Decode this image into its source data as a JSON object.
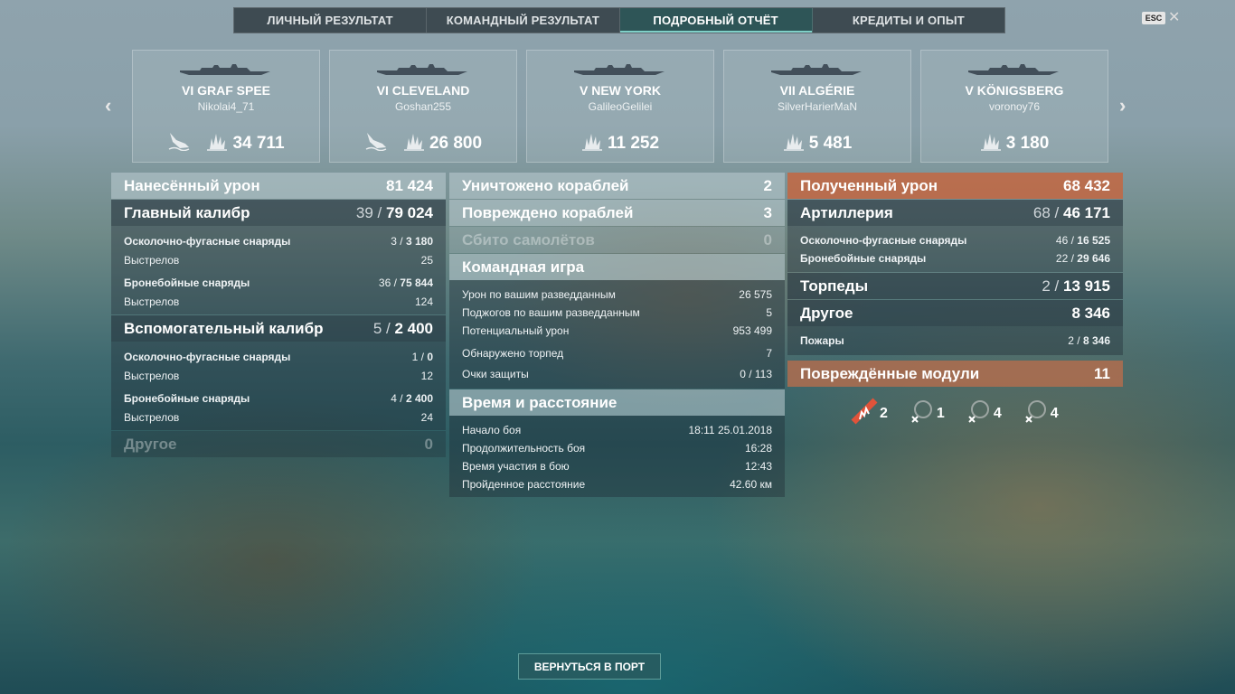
{
  "tabs": [
    "ЛИЧНЫЙ РЕЗУЛЬТАТ",
    "КОМАНДНЫЙ РЕЗУЛЬТАТ",
    "ПОДРОБНЫЙ ОТЧЁТ",
    "КРЕДИТЫ И ОПЫТ"
  ],
  "active_tab": 2,
  "esc_label": "ESC",
  "ships": [
    {
      "tier_name": "VI GRAF SPEE",
      "player": "Nikolai4_71",
      "damage": "34 711",
      "sunk": true
    },
    {
      "tier_name": "VI CLEVELAND",
      "player": "Goshan255",
      "damage": "26 800",
      "sunk": true
    },
    {
      "tier_name": "V NEW YORK",
      "player": "GalileoGelilei",
      "damage": "11 252",
      "sunk": false
    },
    {
      "tier_name": "VII ALGÉRIE",
      "player": "SilverHarierMaN",
      "damage": "5 481",
      "sunk": false
    },
    {
      "tier_name": "V KÖNIGSBERG",
      "player": "voronoy76",
      "damage": "3 180",
      "sunk": false
    }
  ],
  "dealt": {
    "title": "Нанесённый урон",
    "total": "81 424",
    "main": {
      "label": "Главный калибр",
      "hits": "39",
      "dmg": "79 024",
      "he": {
        "label": "Осколочно-фугасные снаряды",
        "hits": "3",
        "dmg": "3 180",
        "shots_label": "Выстрелов",
        "shots": "25"
      },
      "ap": {
        "label": "Бронебойные снаряды",
        "hits": "36",
        "dmg": "75 844",
        "shots_label": "Выстрелов",
        "shots": "124"
      }
    },
    "secondary": {
      "label": "Вспомогательный калибр",
      "hits": "5",
      "dmg": "2 400",
      "he": {
        "label": "Осколочно-фугасные снаряды",
        "hits": "1",
        "dmg": "0",
        "shots_label": "Выстрелов",
        "shots": "12"
      },
      "ap": {
        "label": "Бронебойные снаряды",
        "hits": "4",
        "dmg": "2 400",
        "shots_label": "Выстрелов",
        "shots": "24"
      }
    },
    "other": {
      "label": "Другое",
      "value": "0"
    }
  },
  "middle": {
    "destroyed": {
      "label": "Уничтожено кораблей",
      "value": "2"
    },
    "damaged": {
      "label": "Повреждено кораблей",
      "value": "3"
    },
    "planes": {
      "label": "Сбито самолётов",
      "value": "0"
    },
    "team": {
      "title": "Командная игра",
      "rows": [
        {
          "label": "Урон по вашим разведданным",
          "value": "26 575"
        },
        {
          "label": "Поджогов по вашим разведданным",
          "value": "5"
        },
        {
          "label": "Потенциальный урон",
          "value": "953 499"
        },
        {
          "label": "Обнаружено торпед",
          "value": "7"
        },
        {
          "label": "Очки защиты",
          "value": "0 / 113"
        }
      ]
    },
    "time": {
      "title": "Время и расстояние",
      "rows": [
        {
          "label": "Начало боя",
          "value": "18:11  25.01.2018"
        },
        {
          "label": "Продолжительность боя",
          "value": "16:28"
        },
        {
          "label": "Время участия в бою",
          "value": "12:43"
        },
        {
          "label": "Пройденное расстояние",
          "value": "42.60 км"
        }
      ]
    }
  },
  "received": {
    "title": "Полученный урон",
    "total": "68 432",
    "artillery": {
      "label": "Артиллерия",
      "hits": "68",
      "dmg": "46 171",
      "he": {
        "label": "Осколочно-фугасные снаряды",
        "hits": "46",
        "dmg": "16 525"
      },
      "ap": {
        "label": "Бронебойные снаряды",
        "hits": "22",
        "dmg": "29 646"
      }
    },
    "torpedoes": {
      "label": "Торпеды",
      "hits": "2",
      "dmg": "13 915"
    },
    "other": {
      "label": "Другое",
      "value": "8 346",
      "fires": {
        "label": "Пожары",
        "hits": "2",
        "dmg": "8 346"
      }
    },
    "modules": {
      "label": "Повреждённые модули",
      "value": "11",
      "items": [
        {
          "icon": "main-battery-icon",
          "count": "2",
          "color": "#e0533a"
        },
        {
          "icon": "torpedo-tube-icon",
          "count": "1",
          "color": "#cfcfcf"
        },
        {
          "icon": "secondary-battery-icon",
          "count": "4",
          "color": "#cfcfcf"
        },
        {
          "icon": "steering-icon",
          "count": "4",
          "color": "#cfcfcf"
        }
      ]
    }
  },
  "back_button": "ВЕРНУТЬСЯ В ПОРТ",
  "colors": {
    "accent": "#7fd0c8",
    "received": "#c8643c",
    "critical": "#e0533a"
  }
}
